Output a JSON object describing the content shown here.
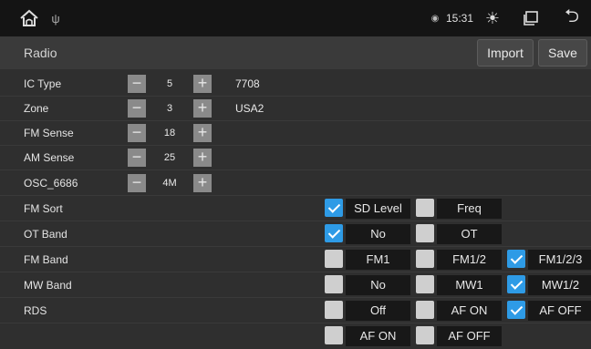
{
  "status": {
    "time": "15:31"
  },
  "title": "Radio",
  "buttons": {
    "import": "Import",
    "save": "Save"
  },
  "rows": [
    {
      "label": "IC Type",
      "value": "5",
      "desc": "7708"
    },
    {
      "label": "Zone",
      "value": "3",
      "desc": "USA2"
    },
    {
      "label": "FM Sense",
      "value": "18"
    },
    {
      "label": "AM Sense",
      "value": "25"
    },
    {
      "label": "OSC_6686",
      "value": "4M"
    }
  ],
  "options": [
    {
      "label": "FM Sort",
      "opts": [
        {
          "text": "SD Level",
          "checked": true
        },
        {
          "text": "Freq",
          "checked": false
        }
      ]
    },
    {
      "label": "OT Band",
      "opts": [
        {
          "text": "No",
          "checked": true
        },
        {
          "text": "OT",
          "checked": false
        }
      ]
    },
    {
      "label": "FM Band",
      "opts": [
        {
          "text": "FM1",
          "checked": false
        },
        {
          "text": "FM1/2",
          "checked": false
        },
        {
          "text": "FM1/2/3",
          "checked": true
        }
      ]
    },
    {
      "label": "MW Band",
      "opts": [
        {
          "text": "No",
          "checked": false
        },
        {
          "text": "MW1",
          "checked": false
        },
        {
          "text": "MW1/2",
          "checked": true
        }
      ]
    },
    {
      "label": "RDS",
      "opts": [
        {
          "text": "Off",
          "checked": false
        },
        {
          "text": "AF ON",
          "checked": false
        },
        {
          "text": "AF OFF",
          "checked": true
        }
      ]
    }
  ],
  "partial": {
    "opts": [
      {
        "text": "AF ON",
        "checked": false
      },
      {
        "text": "AF OFF",
        "checked": false
      }
    ]
  },
  "icons": {
    "home": "home-icon",
    "usb": "usb-icon",
    "location": "location-icon",
    "brightness": "brightness-icon",
    "recent": "recent-apps-icon",
    "back": "back-icon"
  },
  "colors": {
    "checked": "#2e9be6",
    "unchecked": "#cfcfcf",
    "optionBox": "#181818",
    "background": "#2f2f2f"
  }
}
